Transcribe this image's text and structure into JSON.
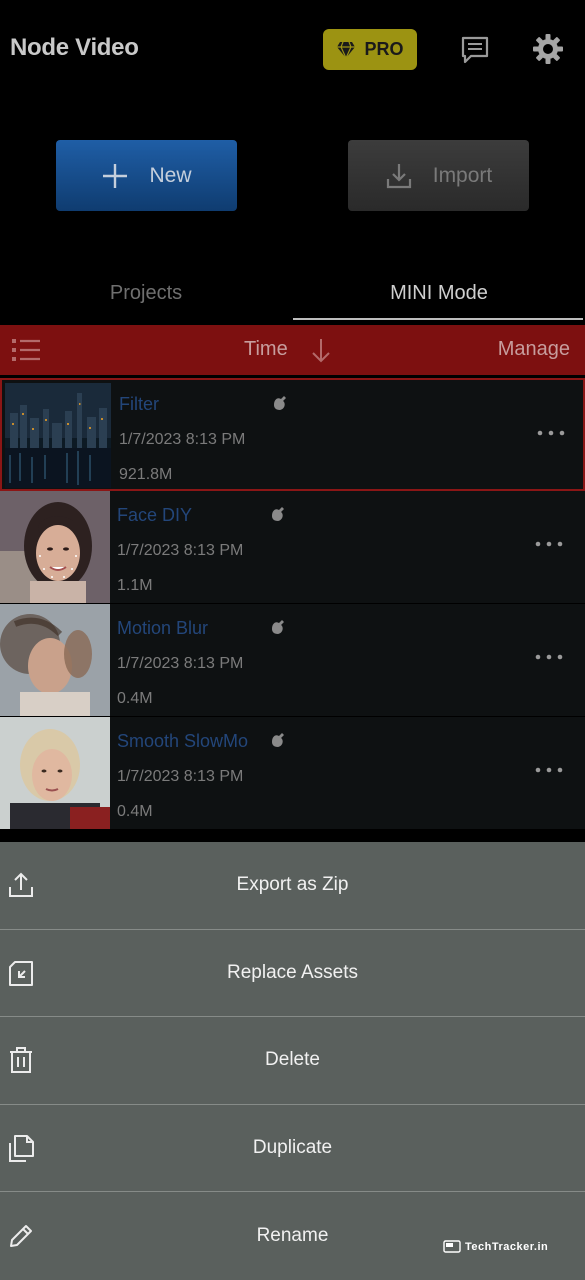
{
  "header": {
    "title": "Node Video",
    "pro_label": "PRO",
    "icons": [
      "diamond-icon",
      "message-icon",
      "gear-icon"
    ]
  },
  "actions": {
    "new_label": "New",
    "import_label": "Import"
  },
  "tabs": [
    {
      "label": "Projects",
      "active": false
    },
    {
      "label": "MINI Mode",
      "active": true
    }
  ],
  "sortbar": {
    "sort_label": "Time",
    "manage_label": "Manage"
  },
  "projects": [
    {
      "title": "Filter",
      "date": "1/7/2023 8:13 PM",
      "size": "921.8M",
      "selected": true
    },
    {
      "title": "Face DIY",
      "date": "1/7/2023 8:13 PM",
      "size": "1.1M",
      "selected": false
    },
    {
      "title": "Motion Blur",
      "date": "1/7/2023 8:13 PM",
      "size": "0.4M",
      "selected": false
    },
    {
      "title": "Smooth SlowMo",
      "date": "1/7/2023 8:13 PM",
      "size": "0.4M",
      "selected": false
    }
  ],
  "action_sheet": [
    {
      "label": "Export as Zip",
      "icon": "export-icon"
    },
    {
      "label": "Replace Assets",
      "icon": "replace-icon"
    },
    {
      "label": "Delete",
      "icon": "trash-icon"
    },
    {
      "label": "Duplicate",
      "icon": "duplicate-icon"
    },
    {
      "label": "Rename",
      "icon": "pencil-icon"
    }
  ],
  "watermark": "TechTracker.in",
  "colors": {
    "pro_bg": "#9c9312",
    "new_bg": "#1f5ea6",
    "sortbar_bg": "#7d1010",
    "title_blue": "#23467a",
    "sheet_bg": "#5a605d"
  }
}
